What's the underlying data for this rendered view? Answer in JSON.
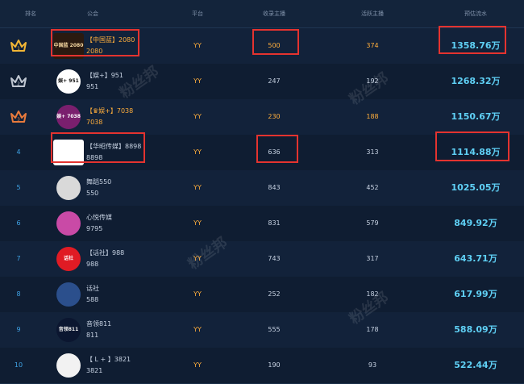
{
  "header": {
    "rank": "排名",
    "guild": "公会",
    "platform": "平台",
    "signed": "收录主播",
    "active": "活跃主播",
    "flow": "预估流水"
  },
  "watermark": "粉丝邦",
  "colors": {
    "accent_flow": "#5fd0f5",
    "highlight_orange": "#ffae3c",
    "annotation_red": "#e4332f",
    "crown_gold": "#f1b535",
    "crown_silver": "#bfc6d1",
    "crown_bronze": "#e87a3c"
  },
  "rows": [
    {
      "rank": "1",
      "crown": "gold-crown-icon",
      "name": "【中国蓝】2080",
      "id": "2080",
      "platform": "YY",
      "signed": "500",
      "active": "374",
      "flow": "1358.76万",
      "highlight": true
    },
    {
      "rank": "2",
      "crown": "silver-crown-icon",
      "name": "【娱+】951",
      "id": "951",
      "platform": "YY",
      "signed": "247",
      "active": "192",
      "flow": "1268.32万",
      "highlight": false
    },
    {
      "rank": "3",
      "crown": "bronze-crown-icon",
      "name": "【♛娱+】7038",
      "id": "7038",
      "platform": "YY",
      "signed": "230",
      "active": "188",
      "flow": "1150.67万",
      "highlight": true
    },
    {
      "rank": "4",
      "name": "【华昭传媒】8898",
      "id": "8898",
      "platform": "YY",
      "signed": "636",
      "active": "313",
      "flow": "1114.88万",
      "highlight": false
    },
    {
      "rank": "5",
      "name": "舞蹈550",
      "id": "550",
      "platform": "YY",
      "signed": "843",
      "active": "452",
      "flow": "1025.05万",
      "highlight": false
    },
    {
      "rank": "6",
      "name": "心悦传媒",
      "id": "9795",
      "platform": "YY",
      "signed": "831",
      "active": "579",
      "flow": "849.92万",
      "highlight": false
    },
    {
      "rank": "7",
      "name": "【话社】988",
      "id": "988",
      "platform": "YY",
      "signed": "743",
      "active": "317",
      "flow": "643.71万",
      "highlight": false
    },
    {
      "rank": "8",
      "name": "话社",
      "id": "588",
      "platform": "YY",
      "signed": "252",
      "active": "182",
      "flow": "617.99万",
      "highlight": false
    },
    {
      "rank": "9",
      "name": "音领811",
      "id": "811",
      "platform": "YY",
      "signed": "555",
      "active": "178",
      "flow": "588.09万",
      "highlight": false
    },
    {
      "rank": "10",
      "name": "【 L + 】3821",
      "id": "3821",
      "platform": "YY",
      "signed": "190",
      "active": "93",
      "flow": "522.44万",
      "highlight": false
    }
  ],
  "avatars": [
    {
      "text": "中国蓝 2080",
      "bg": "#2a1a10",
      "fg": "#f5d7a0",
      "wide": true
    },
    {
      "text": "娱+ 951",
      "bg": "#ffffff",
      "fg": "#111111",
      "wide": false
    },
    {
      "text": "娱+ 7038",
      "bg": "#7a1f6e",
      "fg": "#ffffff",
      "wide": false
    },
    {
      "text": "",
      "bg": "#ffffff",
      "fg": "#2a4fa8",
      "wide": true
    },
    {
      "text": "",
      "bg": "#d9d9d9",
      "fg": "#777777",
      "wide": false
    },
    {
      "text": "",
      "bg": "#c94aa6",
      "fg": "#ffffff",
      "wide": false
    },
    {
      "text": "话社",
      "bg": "#e01b24",
      "fg": "#ffffff",
      "wide": false
    },
    {
      "text": "",
      "bg": "#2b4f8c",
      "fg": "#cfe0ff",
      "wide": false
    },
    {
      "text": "音领811",
      "bg": "#0b1630",
      "fg": "#e8e8e8",
      "wide": false
    },
    {
      "text": "",
      "bg": "#f2f2f2",
      "fg": "#1c3f8f",
      "wide": false
    }
  ]
}
